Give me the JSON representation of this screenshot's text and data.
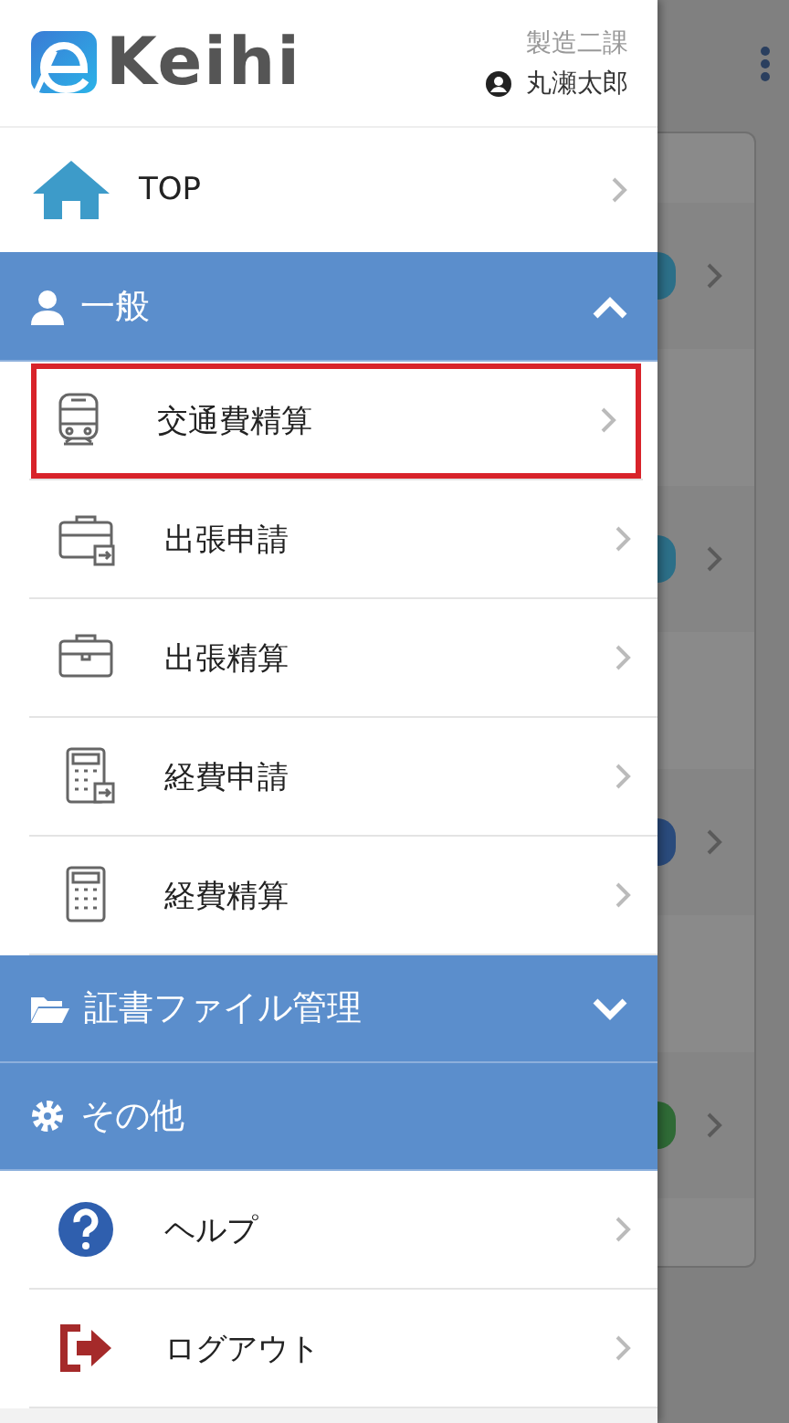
{
  "header": {
    "logo_text": "Keihi",
    "department": "製造二課",
    "user": "丸瀬太郎"
  },
  "menu": [
    {
      "kind": "link",
      "label": "TOP"
    },
    {
      "kind": "toggle",
      "label": "一般",
      "expanded": true,
      "children": [
        {
          "label": "交通費精算",
          "highlighted": true
        },
        {
          "label": "出張申請",
          "highlighted": false
        },
        {
          "label": "出張精算",
          "highlighted": false
        },
        {
          "label": "経費申請",
          "highlighted": false
        },
        {
          "label": "経費精算",
          "highlighted": false
        }
      ]
    },
    {
      "kind": "toggle",
      "label": "証書ファイル管理",
      "expanded": false
    },
    {
      "kind": "group",
      "label": "その他",
      "children": [
        {
          "label": "ヘルプ",
          "highlighted": false
        },
        {
          "label": "ログアウト",
          "highlighted": false
        }
      ]
    }
  ],
  "list_items": [
    {
      "color": "#2c6f88"
    },
    {
      "color": "#2c6f88"
    },
    {
      "color": "#2a4b7c"
    },
    {
      "color": "#2f6a36"
    }
  ]
}
